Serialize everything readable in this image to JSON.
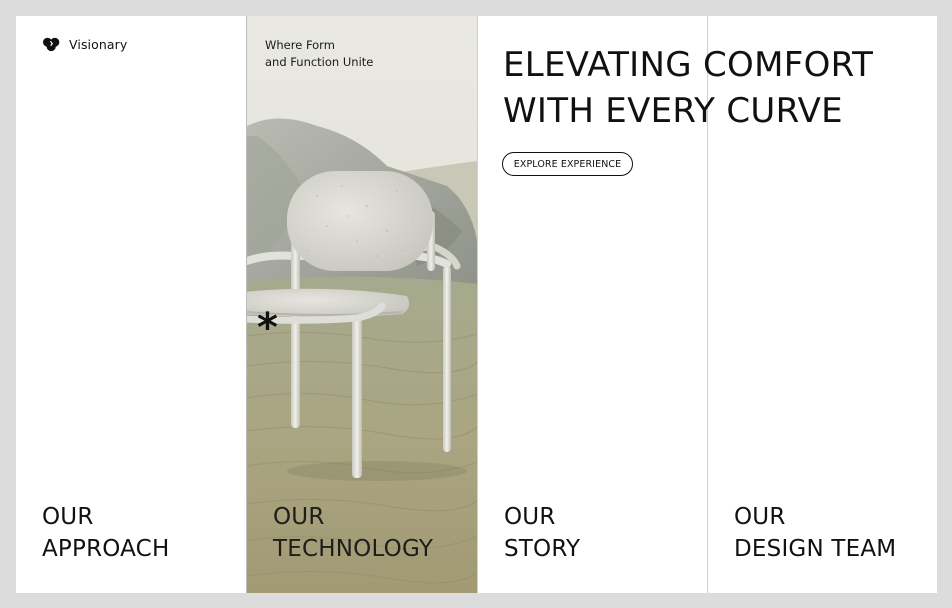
{
  "brand": {
    "name": "Visionary",
    "logo_icon": "cloud-heart-icon"
  },
  "tagline": {
    "line1": "Where Form",
    "line2": "and Function Unite"
  },
  "hero": {
    "headline_line1": "ELEVATING COMFORT",
    "headline_line2": "WITH EVERY CURVE",
    "cta_label": "EXPLORE EXPERIENCE",
    "image": "white chair on sand dunes"
  },
  "nav": [
    {
      "line1": "OUR",
      "line2": "APPROACH"
    },
    {
      "line1": "OUR",
      "line2": "TECHNOLOGY"
    },
    {
      "line1": "OUR",
      "line2": "STORY"
    },
    {
      "line1": "OUR",
      "line2": "DESIGN TEAM"
    }
  ],
  "decor": {
    "asterisk": "*"
  },
  "colors": {
    "background": "#dcdcdc",
    "panel": "#ffffff",
    "text": "#111111",
    "sand": "#b9b491",
    "sky": "#e4e4dc"
  }
}
